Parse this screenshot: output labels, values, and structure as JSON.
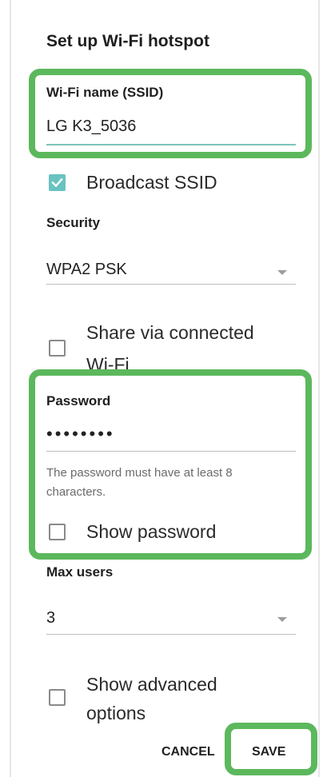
{
  "dialog": {
    "title": "Set up Wi-Fi hotspot"
  },
  "ssid": {
    "label": "Wi-Fi name (SSID)",
    "value": "LG K3_5036"
  },
  "broadcast": {
    "label": "Broadcast SSID",
    "checked": true
  },
  "security": {
    "label": "Security",
    "selected": "WPA2 PSK"
  },
  "share_wifi": {
    "label_line1": "Share via connected",
    "label_line2": "Wi-Fi",
    "checked": false
  },
  "password": {
    "label": "Password",
    "value": "••••••••",
    "hint_line1": "The password must have at least 8",
    "hint_line2": "characters."
  },
  "show_password": {
    "label": "Show password",
    "checked": false
  },
  "max_users": {
    "label": "Max users",
    "selected": "3"
  },
  "advanced": {
    "label_line1": "Show advanced",
    "label_line2": "options",
    "checked": false
  },
  "buttons": {
    "cancel": "CANCEL",
    "save": "SAVE"
  },
  "colors": {
    "accent_teal": "#69c3c0",
    "highlight_green": "#5cb85c"
  },
  "icons": {
    "checkbox_checked": "check-icon",
    "dropdown": "triangle-down-icon"
  }
}
